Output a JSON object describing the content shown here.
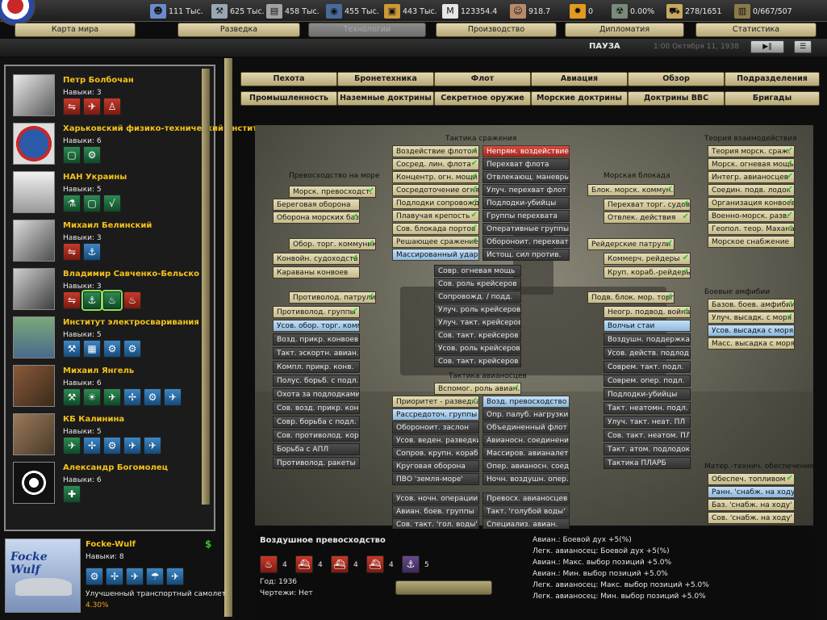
{
  "topbar": {
    "resources": [
      {
        "name": "manpower-icon",
        "value": "111 Тыс."
      },
      {
        "name": "industry-icon",
        "value": "625 Тыс."
      },
      {
        "name": "metal-icon",
        "value": "458 Тыс."
      },
      {
        "name": "oil-icon",
        "value": "455 Тыс."
      },
      {
        "name": "supplies-icon",
        "value": "443 Тыс."
      },
      {
        "name": "money-icon",
        "value": "123354.4"
      },
      {
        "name": "leader-icon",
        "value": "918.7"
      },
      {
        "name": "bomb-icon",
        "value": "0"
      },
      {
        "name": "nuclear-icon",
        "value": "0.00%"
      },
      {
        "name": "transport-icon",
        "value": "278/1651"
      },
      {
        "name": "factory-icon",
        "value": "0/667/507"
      }
    ]
  },
  "main_tabs": [
    {
      "label": "Карта мира",
      "active": false
    },
    {
      "label": "Разведка",
      "active": false
    },
    {
      "label": "Технологии",
      "active": true
    },
    {
      "label": "Производство",
      "active": false
    },
    {
      "label": "Дипломатия",
      "active": false
    },
    {
      "label": "Статистика",
      "active": false
    }
  ],
  "status": {
    "pause": "ПАУЗА",
    "date": "1:00 Октября 11, 1938"
  },
  "orgs": [
    {
      "name": "Петр Болбочан",
      "skill": "Навыки: 3"
    },
    {
      "name": "Харьковский физико-технический инстит",
      "skill": "Навыки: 6"
    },
    {
      "name": "НАН Украины",
      "skill": "Навыки: 5"
    },
    {
      "name": "Михаил Белинский",
      "skill": "Навыки: 3"
    },
    {
      "name": "Владимир Савченко-Бельско",
      "skill": "Навыки: 3"
    },
    {
      "name": "Институт электросваривания",
      "skill": "Навыки: 5"
    },
    {
      "name": "Михаил Янгель",
      "skill": "Навыки: 6"
    },
    {
      "name": "КБ Калинина",
      "skill": "Навыки: 5"
    },
    {
      "name": "Александр Богомолец",
      "skill": "Навыки: 6"
    }
  ],
  "bottom_org": {
    "name": "Focke-Wulf",
    "logo": "Focke Wulf",
    "skill": "Навыки: 8",
    "project": "Улучшенный транспортный самолет",
    "percent": "4.30%"
  },
  "category_tabs": [
    "Пехота",
    "Бронетехника",
    "Флот",
    "Авиация",
    "Обзор",
    "Подразделения",
    "Промышленность",
    "Наземные доктрины",
    "Секретное оружие",
    "Морские доктрины",
    "Доктрины ВВС",
    "Бригады"
  ],
  "headers": {
    "sea_superiority": "Превосходство на море",
    "combat_tactics": "Тактика сражения",
    "naval_blockade": "Морская блокада",
    "interaction_theory": "Теория взаимодействия",
    "carrier_tactics": "Тактика авианосцев",
    "amphibious": "Боевые амфибии",
    "logistics": "Матер.-технич. обеспечение"
  },
  "tech": {
    "sea_sup": [
      "Морск. превосходст.",
      "Береговая оборона",
      "Оборона морских баз",
      "Обор. торг. коммуник.",
      "Конвойн. судоходств",
      "Караваны конвоев",
      "Противолод. патрули",
      "Противолод. группы",
      "Усов. обор. торг. комм.",
      "Возд. прикр. конвоев",
      "Такт. эскортн. авиан.",
      "Компл. прикр. конв.",
      "Полуc. борьб. с подл.",
      "Охота за подлодками",
      "Сов. возд. прикр. конв.",
      "Совр. борьба с подл.",
      "Сов. противолод. кор.",
      "Борьба с АПЛ",
      "Противолод. ракеты"
    ],
    "combat_left": [
      "Воздействие флотом",
      "Сосред. лин. флота",
      "Концентр. огн. мощи",
      "Сосредоточение огня",
      "Подлодки сопровожд.",
      "Плавучая крепость",
      "Сов. блокада портов",
      "Решающее сражение",
      "Массированный удар"
    ],
    "combat_right": [
      "Непрям. воздействие",
      "Перехват флота",
      "Отвлекающ. маневры",
      "Улуч. перехват флот",
      "Подлодки-убийцы",
      "Группы перехвата",
      "Оперативные группы",
      "Обороноит. перехват",
      "Истощ. сил против."
    ],
    "combat_mid": [
      "Совр. огневая мощь",
      "Сов. роль крейсеров",
      "Сопровожд. / подд.",
      "Улуч. роль крейсеров",
      "Улуч. такт. крейсеров",
      "Сов. такт. крейсеров",
      "Усов. роль крейсеров",
      "Сов. такт. крейсеров"
    ],
    "carrier_top": "Вспомог. роль авиан.",
    "carrier_left": [
      "Приоритет - разведка",
      "Рассредоточ. группы",
      "Обороноит. заслон",
      "Усов. веден. разведки",
      "Сопров. крупн. кораб.",
      "Круговая оборона",
      "ПВО 'земля-море'",
      "Усов. ночн. операции",
      "Авиан. боев. группы",
      "Сов. такт. 'гол. воды'"
    ],
    "carrier_right": [
      "Возд. превосходство",
      "Опр. палуб. нагрузки",
      "Объединенный флот",
      "Авианосн. соединение",
      "Массиров. авианалет",
      "Опер. авианосн. соед.",
      "Ночн. воздушн. опер.",
      "Превосх. авианосцев",
      "Такт. 'голубой воды'",
      "Специализ. авиан."
    ],
    "blockade": [
      "Блок. морск. коммун.",
      "Перехват торг. судов",
      "Отвлек. действия",
      "Рейдерские патрули",
      "Коммерч. рейдеры",
      "Круп. кораб.-рейдеры",
      "Подв. блок. мор. торг.",
      "Неогр. подвод. война",
      "Волчьи стаи",
      "Воздушн. поддержка",
      "Усов. действ. подлод",
      "Соврем. такт. подл.",
      "Соврем. опер. подл.",
      "Подлодки-убийцы",
      "Такт. неатомн. подл.",
      "Улуч. такт. неат. ПЛ",
      "Сов. такт. неатом. ПЛ",
      "Такт. атом. подлодок",
      "Тактика ПЛАРБ"
    ],
    "interaction": [
      "Теория морск. сраж.",
      "Морск. огневая мощь",
      "Интегр. авианосцев",
      "Соедин. подв. лодок",
      "Организация конвоев",
      "Военно-морск. разв.",
      "Геопол. теор. Махана",
      "Морское снабжение"
    ],
    "amphib": [
      "Базов. боев. амфибии",
      "Улуч. высадк. с моря",
      "Усов. высадка с моря",
      "Масс. высадка с моря"
    ],
    "logistics": [
      "Обеспеч. топливом",
      "Ранн. 'снабж. на ходу'",
      "Баз. 'снабж. на ходу'",
      "Сов. 'снабж. на ходу'"
    ]
  },
  "info": {
    "title": "Воздушное превосходство",
    "components": [
      "4",
      "4",
      "4",
      "4",
      "5"
    ],
    "year": "Год: 1936",
    "blueprints": "Чертежи: Нет",
    "effects": [
      "Авиан.: Боевой дух +5(%)",
      "Легк. авианосец: Боевой дух +5(%)",
      "Авиан.: Макс. выбор позиций +5.0%",
      "Авиан.: Мин. выбор позиций +5.0%",
      "Легк. авианосец: Макс. выбор позиций +5.0%",
      "Легк. авианосец: Мин. выбор позиций +5.0%"
    ]
  }
}
